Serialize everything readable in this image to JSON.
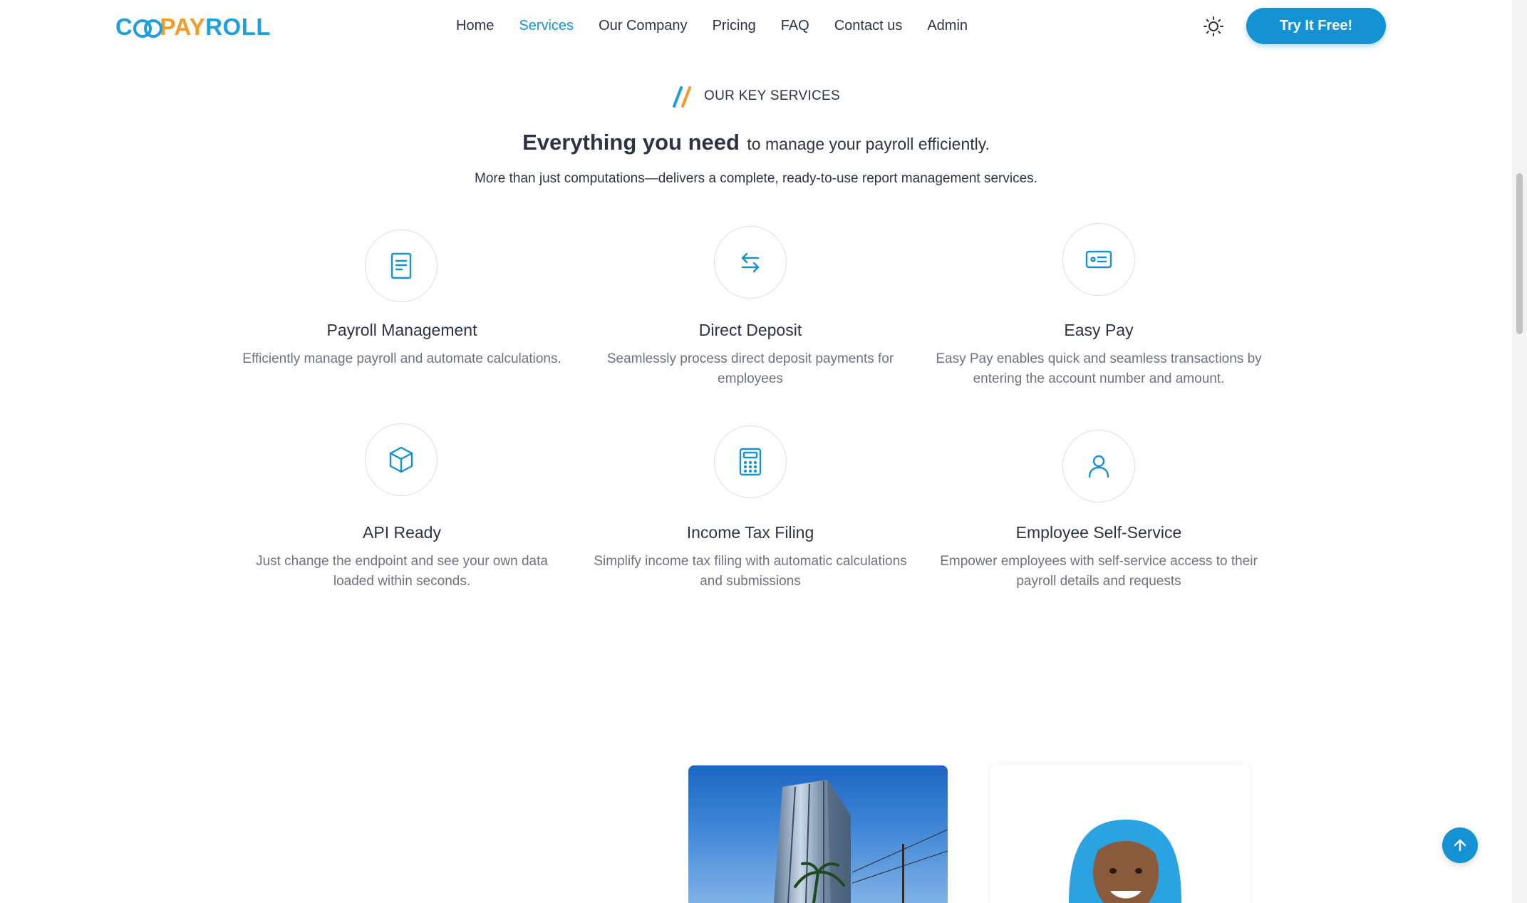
{
  "header": {
    "logo": {
      "part1": "C",
      "part2": "PAY",
      "part3": "ROLL"
    },
    "nav": [
      {
        "label": "Home",
        "active": false
      },
      {
        "label": "Services",
        "active": true
      },
      {
        "label": "Our Company",
        "active": false
      },
      {
        "label": "Pricing",
        "active": false
      },
      {
        "label": "FAQ",
        "active": false
      },
      {
        "label": "Contact us",
        "active": false
      },
      {
        "label": "Admin",
        "active": false
      }
    ],
    "theme_icon": "sun-icon",
    "cta_label": "Try It Free!"
  },
  "section": {
    "eyebrow": "OUR KEY SERVICES",
    "headline_strong": "Everything you need",
    "headline_light": "to manage your payroll efficiently.",
    "subline": "More than just computations—delivers a complete, ready-to-use report management services."
  },
  "services": [
    {
      "icon": "document-icon",
      "title": "Payroll Management",
      "description": "Efficiently manage payroll and automate calculations."
    },
    {
      "icon": "transfer-arrows-icon",
      "title": "Direct Deposit",
      "description": "Seamlessly process direct deposit payments for employees"
    },
    {
      "icon": "id-card-icon",
      "title": "Easy Pay",
      "description": "Easy Pay enables quick and seamless transactions by entering the account number and amount."
    },
    {
      "icon": "cube-icon",
      "title": "API Ready",
      "description": "Just change the endpoint and see your own data loaded within seconds."
    },
    {
      "icon": "calculator-icon",
      "title": "Income Tax Filing",
      "description": "Simplify income tax filing with automatic calculations and submissions"
    },
    {
      "icon": "user-icon",
      "title": "Employee Self-Service",
      "description": "Empower employees with self-service access to their payroll details and requests"
    }
  ],
  "colors": {
    "brand_blue": "#1492d3",
    "brand_orange": "#f39a2b",
    "text_dark": "#2b3445",
    "text_muted": "#6b7280"
  },
  "floating": {
    "back_to_top_icon": "arrow-up-icon"
  }
}
